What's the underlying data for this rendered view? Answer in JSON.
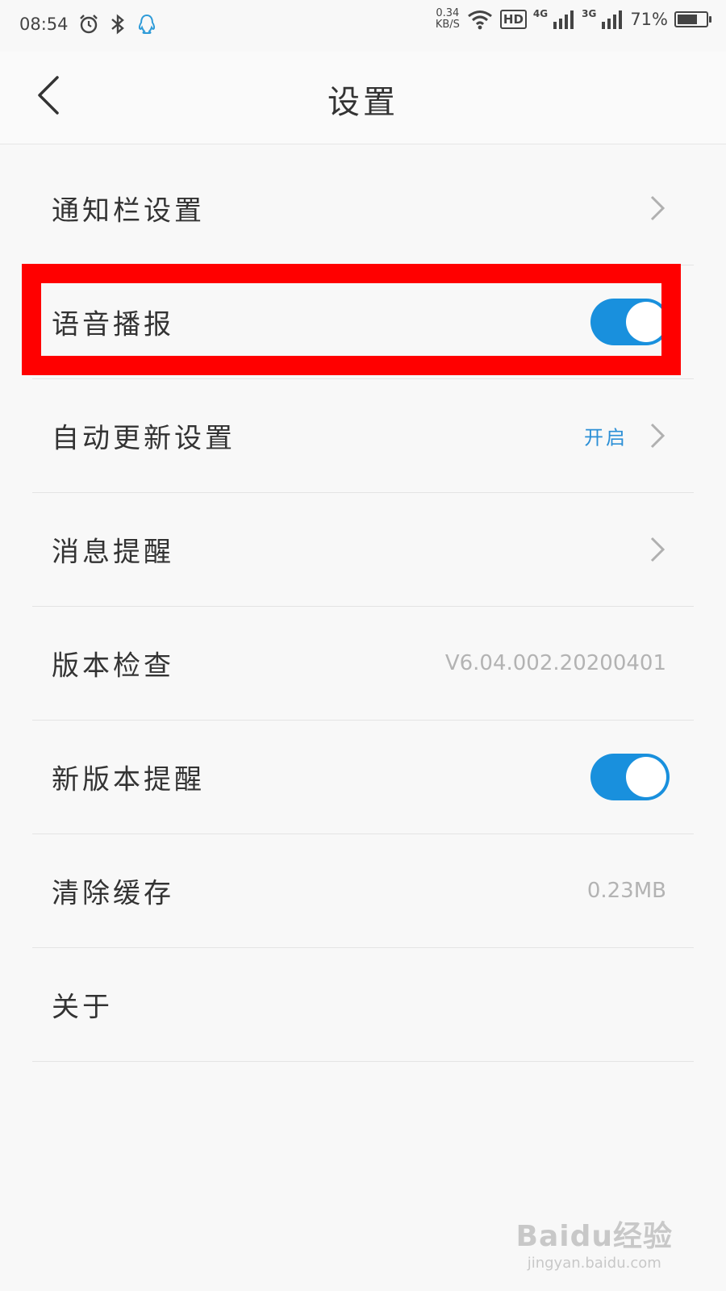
{
  "status_bar": {
    "time": "08:54",
    "net_speed_value": "0.34",
    "net_speed_unit": "KB/S",
    "hd": "HD",
    "signal_1": "4G",
    "signal_2": "3G",
    "battery_text": "71%",
    "battery_level": 0.71
  },
  "header": {
    "title": "设置"
  },
  "settings": [
    {
      "label": "通知栏设置"
    },
    {
      "label": "语音播报",
      "toggle_on": true
    },
    {
      "label": "自动更新设置",
      "value": "开启"
    },
    {
      "label": "消息提醒"
    },
    {
      "label": "版本检查",
      "value": "V6.04.002.20200401"
    },
    {
      "label": "新版本提醒",
      "toggle_on": true
    },
    {
      "label": "清除缓存",
      "value": "0.23MB"
    },
    {
      "label": "关于"
    }
  ],
  "watermark": {
    "brand": "Baidu经验",
    "url": "jingyan.baidu.com"
  },
  "colors": {
    "toggle_on": "#1990dd",
    "link": "#2b8fd6",
    "highlight": "#ff0000"
  }
}
